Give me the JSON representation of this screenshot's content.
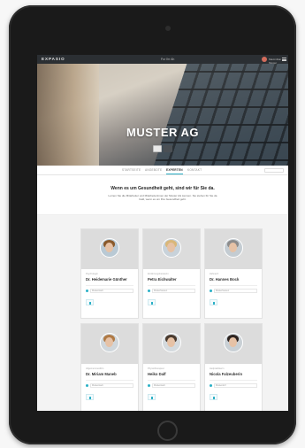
{
  "app": {
    "logo": "EXPASIO",
    "topbar_center": "Fur Ihr Ah",
    "user_name": "Maximilian Muster"
  },
  "hero": {
    "title": "MUSTER AG"
  },
  "tabs": [
    {
      "label": "STARTSEITE"
    },
    {
      "label": "ANGEBOTE"
    },
    {
      "label": "EXPERTEN"
    },
    {
      "label": "KONTAKT"
    }
  ],
  "active_tab": "EXPERTEN",
  "intro": {
    "title": "Wenn es um Gesundheit geht, sind wir für Sie da.",
    "text": "Lernen Sie die Mitarbeiter und Mitarbeiterinnen der Muster AG kennen. Sie stehen für Sie da bald, wenn es um Ihre Gesundheit geht."
  },
  "experts": [
    {
      "role": "Psychologin",
      "name": "Dr. Heidemarie Günther",
      "location": "Musterstadt"
    },
    {
      "role": "Ernährungsberaterin",
      "name": "Petra Eichwalter",
      "location": "Musterhausen"
    },
    {
      "role": "Zahnarzt",
      "name": "Dr. Hannes Bock",
      "location": "Musterhausen"
    },
    {
      "role": "Allgemeinmedizin",
      "name": "Dr. Miriam Maneb",
      "location": "Musterstadt"
    },
    {
      "role": "Physiotherapeut",
      "name": "Heiko Dalf",
      "location": "Musterstadt"
    },
    {
      "role": "Heilpraktikerin",
      "name": "Nicola Falzeuberin",
      "location": "Musterdorf"
    }
  ],
  "colors": {
    "accent": "#2bb0c6",
    "topbar": "#2b2f33"
  },
  "icons": [
    "menu-icon",
    "location-icon",
    "contact-icon"
  ]
}
